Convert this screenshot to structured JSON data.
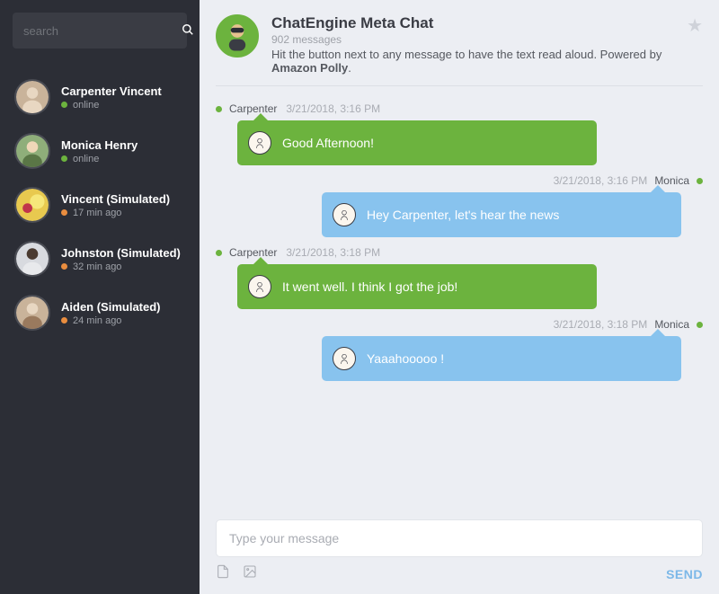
{
  "sidebar": {
    "search_placeholder": "search",
    "contacts": [
      {
        "name": "Carpenter Vincent",
        "status_text": "online",
        "status": "online"
      },
      {
        "name": "Monica Henry",
        "status_text": "online",
        "status": "online"
      },
      {
        "name": "Vincent (Simulated)",
        "status_text": "17 min ago",
        "status": "away"
      },
      {
        "name": "Johnston (Simulated)",
        "status_text": "32 min ago",
        "status": "away"
      },
      {
        "name": "Aiden (Simulated)",
        "status_text": "24 min ago",
        "status": "away"
      }
    ]
  },
  "header": {
    "title": "ChatEngine Meta Chat",
    "message_count": "902 messages",
    "desc_prefix": "Hit the button next to any message to have the text read aloud. Powered by ",
    "desc_bold": "Amazon Polly",
    "desc_suffix": "."
  },
  "messages": [
    {
      "side": "left",
      "user": "Carpenter",
      "dot": "online",
      "time": "3/21/2018, 3:16 PM",
      "color": "green",
      "text": "Good Afternoon!"
    },
    {
      "side": "right",
      "user": "Monica",
      "dot": "online",
      "time": "3/21/2018, 3:16 PM",
      "color": "blue",
      "text": "Hey Carpenter, let's hear the news"
    },
    {
      "side": "left",
      "user": "Carpenter",
      "dot": "online",
      "time": "3/21/2018, 3:18 PM",
      "color": "green",
      "text": "It went well. I think I got the job!"
    },
    {
      "side": "right",
      "user": "Monica",
      "dot": "online",
      "time": "3/21/2018, 3:18 PM",
      "color": "blue",
      "text": "Yaaahooooo !"
    }
  ],
  "composer": {
    "placeholder": "Type your message",
    "send_label": "SEND"
  }
}
